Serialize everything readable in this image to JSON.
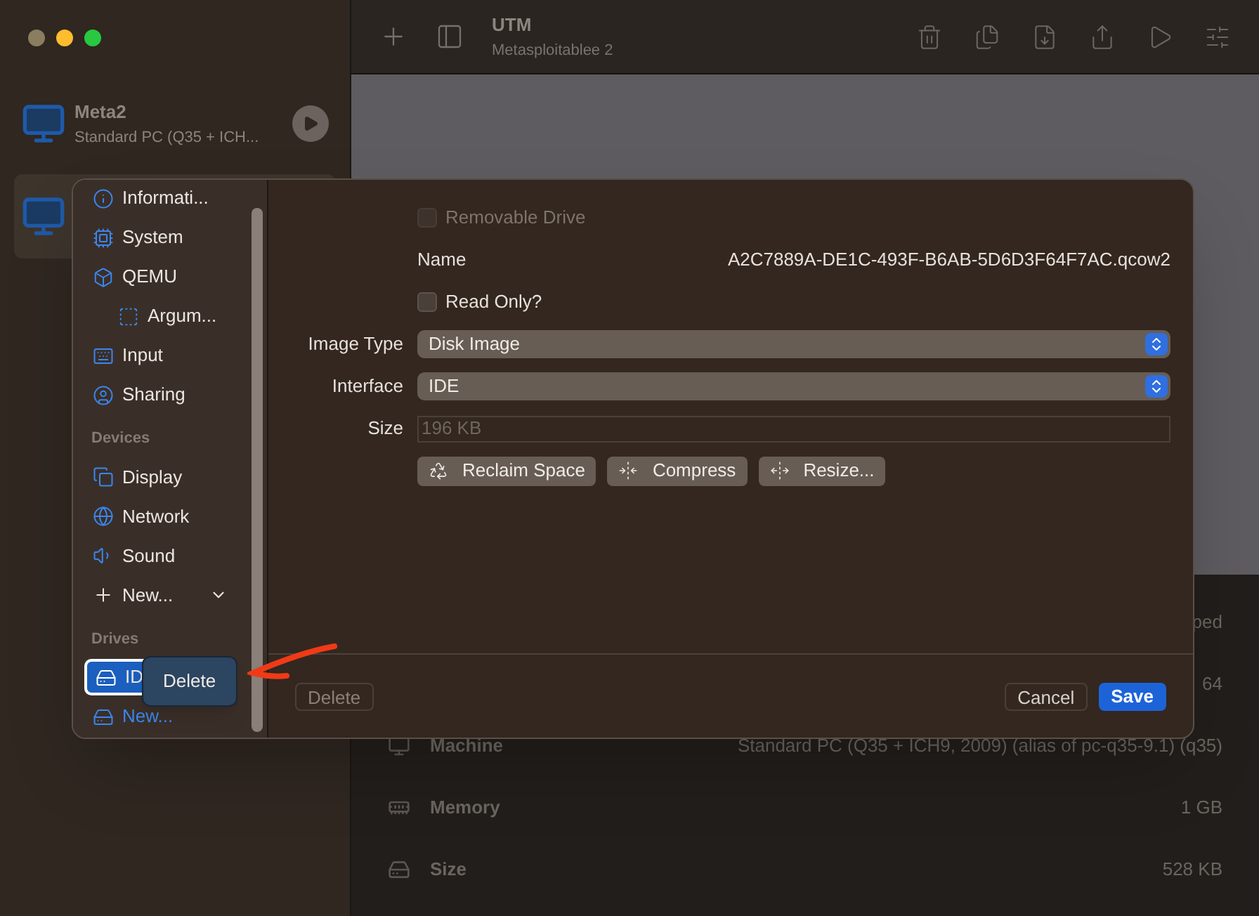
{
  "toolbar": {
    "title": "UTM",
    "subtitle": "Metasploitablee 2"
  },
  "vm_list": [
    {
      "name": "Meta2",
      "subtitle": "Standard PC (Q35 + ICH...",
      "selected": false
    },
    {
      "selected": true
    }
  ],
  "details": [
    {
      "kind": "covered",
      "value": "ped"
    },
    {
      "kind": "covered",
      "value": "64"
    },
    {
      "kind": "machine",
      "label": "Machine",
      "value": "Standard PC (Q35 + ICH9, 2009) (alias of pc-q35-9.1) (q35)"
    },
    {
      "kind": "memory",
      "label": "Memory",
      "value": "1 GB"
    },
    {
      "kind": "drive",
      "label": "Size",
      "value": "528 KB"
    }
  ],
  "dialog": {
    "sidebar": [
      {
        "items": [
          {
            "label": "Informati...",
            "selected": false
          },
          {
            "label": "System",
            "selected": false
          },
          {
            "label": "QEMU",
            "selected": false,
            "children": [
              {
                "label": "Argum...",
                "selected": false
              }
            ]
          },
          {
            "label": "Input",
            "selected": false
          },
          {
            "label": "Sharing",
            "selected": false
          }
        ]
      },
      {
        "title": "Devices",
        "items": [
          {
            "label": "Display",
            "selected": false
          },
          {
            "label": "Network",
            "selected": false
          },
          {
            "label": "Sound",
            "selected": false
          },
          {
            "label": "New...",
            "kind": "menu",
            "selected": false
          }
        ]
      },
      {
        "title": "Drives",
        "items": [
          {
            "label": "ID",
            "selected": true
          },
          {
            "label": "New...",
            "kind": "add",
            "selected": false
          }
        ]
      }
    ],
    "context_menu": {
      "items": [
        "Delete"
      ]
    },
    "form": {
      "removable": {
        "label": "Removable Drive",
        "checked": false,
        "disabled": true
      },
      "name": {
        "label": "Name",
        "value": "A2C7889A-DE1C-493F-B6AB-5D6D3F64F7AC.qcow2"
      },
      "read_only": {
        "label": "Read Only?",
        "checked": false,
        "disabled": false
      },
      "image_type": {
        "label": "Image Type",
        "value": "Disk Image"
      },
      "interface": {
        "label": "Interface",
        "value": "IDE"
      },
      "size": {
        "label": "Size",
        "value": "196 KB",
        "disabled": true
      },
      "actions": [
        "Reclaim Space",
        "Compress",
        "Resize..."
      ]
    },
    "footer": {
      "delete": {
        "label": "Delete",
        "disabled": true
      },
      "cancel": "Cancel",
      "save": "Save"
    }
  }
}
